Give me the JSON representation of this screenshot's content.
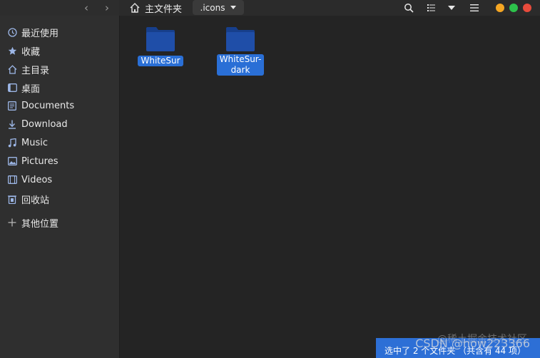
{
  "header": {
    "home_label": "主文件夹",
    "current_folder": ".icons"
  },
  "sidebar": {
    "items": [
      {
        "label": "最近使用",
        "icon": "clock-icon"
      },
      {
        "label": "收藏",
        "icon": "star-icon"
      },
      {
        "label": "主目录",
        "icon": "home-icon"
      },
      {
        "label": "桌面",
        "icon": "desktop-icon"
      },
      {
        "label": "Documents",
        "icon": "document-icon"
      },
      {
        "label": "Download",
        "icon": "download-icon"
      },
      {
        "label": "Music",
        "icon": "music-icon"
      },
      {
        "label": "Pictures",
        "icon": "picture-icon"
      },
      {
        "label": "Videos",
        "icon": "video-icon"
      },
      {
        "label": "回收站",
        "icon": "trash-icon"
      },
      {
        "label": "其他位置",
        "icon": "plus-icon"
      }
    ]
  },
  "files": [
    {
      "line1": "WhiteSur",
      "line2": ""
    },
    {
      "line1": "WhiteSur-",
      "line2": "dark"
    }
  ],
  "status": {
    "text": "选中了 2 个文件夹 （共含有 44 项）"
  },
  "watermark": {
    "csdn": "CSDN @how223366",
    "juejin": "@稀土掘金技术社区"
  },
  "colors": {
    "accent": "#2a6fd6",
    "folder": "#1f4ea8",
    "close": "#e84b3c",
    "maximize": "#2dc24b",
    "minimize": "#f5a623"
  }
}
